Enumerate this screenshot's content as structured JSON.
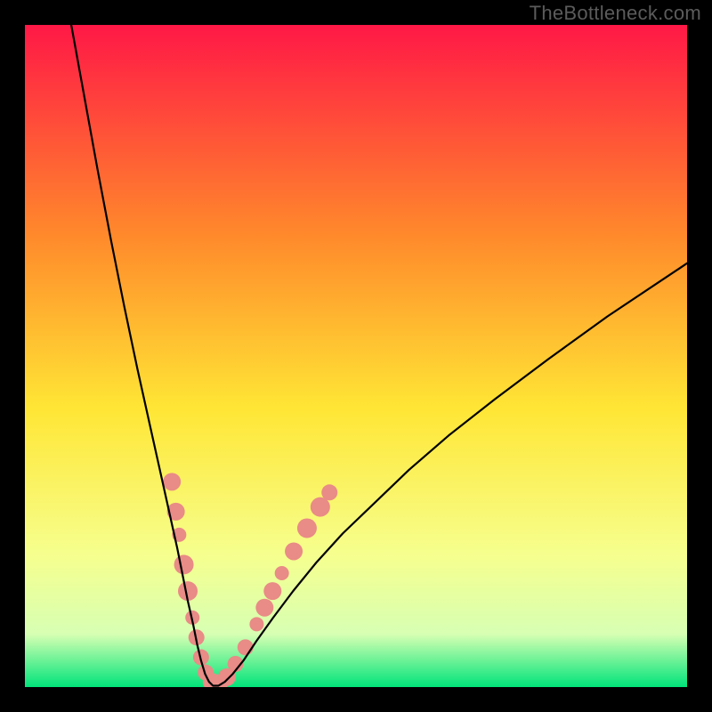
{
  "watermark": "TheBottleneck.com",
  "chart_data": {
    "type": "line",
    "title": "",
    "xlabel": "",
    "ylabel": "",
    "xlim": [
      0,
      100
    ],
    "ylim": [
      0,
      100
    ],
    "gradient_colors": {
      "top": "#ff1846",
      "mid_upper": "#ff8a2b",
      "mid": "#ffe635",
      "mid_lower": "#f6ff8e",
      "band": "#d7ffb3",
      "bottom": "#00e47a"
    },
    "series": [
      {
        "name": "bottleneck-curve",
        "x": [
          7,
          9,
          11,
          13,
          15,
          17,
          19,
          20,
          21,
          22,
          23,
          23.8,
          24.6,
          25.4,
          26,
          26.6,
          27.2,
          27.8,
          28.4,
          29.2,
          30.2,
          31.4,
          33,
          35,
          37.5,
          40.5,
          44,
          48,
          53,
          58,
          64,
          71,
          79,
          88,
          97,
          100
        ],
        "y": [
          100,
          89,
          78,
          67.5,
          57.5,
          48,
          39,
          34.5,
          30,
          25.5,
          21,
          17,
          13,
          9.5,
          6.5,
          4,
          2,
          0.8,
          0.2,
          0.2,
          0.8,
          2,
          4,
          7,
          10.5,
          14.5,
          18.8,
          23.2,
          28,
          32.8,
          38,
          43.5,
          49.5,
          56,
          62,
          64
        ]
      }
    ],
    "markers": {
      "name": "sample-points",
      "color": "#e98b86",
      "points": [
        {
          "x": 22.2,
          "y": 31.0,
          "r": 10
        },
        {
          "x": 22.8,
          "y": 26.5,
          "r": 10
        },
        {
          "x": 23.3,
          "y": 23.0,
          "r": 8
        },
        {
          "x": 24.0,
          "y": 18.5,
          "r": 11
        },
        {
          "x": 24.6,
          "y": 14.5,
          "r": 11
        },
        {
          "x": 25.3,
          "y": 10.5,
          "r": 8
        },
        {
          "x": 25.9,
          "y": 7.5,
          "r": 9
        },
        {
          "x": 26.6,
          "y": 4.5,
          "r": 9
        },
        {
          "x": 27.3,
          "y": 2.2,
          "r": 9
        },
        {
          "x": 28.2,
          "y": 0.8,
          "r": 10
        },
        {
          "x": 29.3,
          "y": 0.5,
          "r": 10
        },
        {
          "x": 30.5,
          "y": 1.5,
          "r": 10
        },
        {
          "x": 31.8,
          "y": 3.5,
          "r": 9
        },
        {
          "x": 33.3,
          "y": 6.0,
          "r": 9
        },
        {
          "x": 35.0,
          "y": 9.5,
          "r": 8
        },
        {
          "x": 36.2,
          "y": 12.0,
          "r": 10
        },
        {
          "x": 37.4,
          "y": 14.5,
          "r": 10
        },
        {
          "x": 38.8,
          "y": 17.2,
          "r": 8
        },
        {
          "x": 40.6,
          "y": 20.5,
          "r": 10
        },
        {
          "x": 42.6,
          "y": 24.0,
          "r": 11
        },
        {
          "x": 44.6,
          "y": 27.2,
          "r": 11
        },
        {
          "x": 46.0,
          "y": 29.4,
          "r": 9
        }
      ]
    }
  }
}
